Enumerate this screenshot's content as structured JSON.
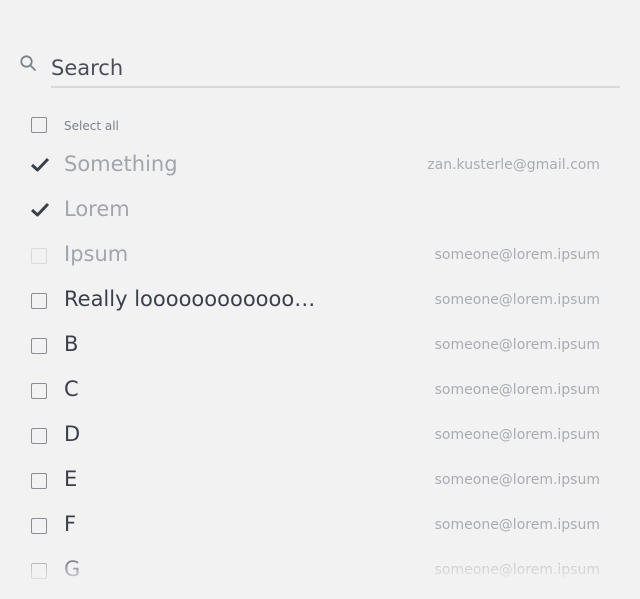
{
  "search": {
    "placeholder": "Search",
    "icon": "search-icon"
  },
  "select_all": {
    "label": "Select all",
    "checked": false
  },
  "items": [
    {
      "label": "Something",
      "email": "zan.kusterle@gmail.com",
      "state": "checked"
    },
    {
      "label": "Lorem",
      "email": "",
      "state": "checked"
    },
    {
      "label": "Ipsum",
      "email": "someone@lorem.ipsum",
      "state": "disabled"
    },
    {
      "label": "Really looooooooooooooooooooong",
      "email": "someone@lorem.ipsum",
      "state": "unchecked"
    },
    {
      "label": "B",
      "email": "someone@lorem.ipsum",
      "state": "unchecked"
    },
    {
      "label": "C",
      "email": "someone@lorem.ipsum",
      "state": "unchecked"
    },
    {
      "label": "D",
      "email": "someone@lorem.ipsum",
      "state": "unchecked"
    },
    {
      "label": "E",
      "email": "someone@lorem.ipsum",
      "state": "unchecked"
    },
    {
      "label": "F",
      "email": "someone@lorem.ipsum",
      "state": "unchecked"
    },
    {
      "label": "G",
      "email": "someone@lorem.ipsum",
      "state": "unchecked"
    }
  ],
  "colors": {
    "background": "#f2f2f2",
    "text": "#3b3f4a",
    "muted_text": "#a2a5ab",
    "checkmark": "#3b3f4a"
  }
}
